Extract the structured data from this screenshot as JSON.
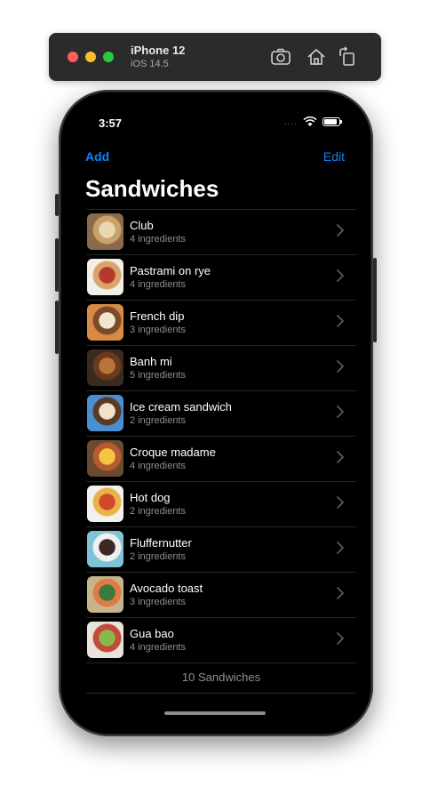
{
  "simulator": {
    "device_name": "iPhone 12",
    "os_version": "iOS 14.5",
    "buttons": [
      "screenshot-icon",
      "home-icon",
      "rotate-icon"
    ]
  },
  "status_bar": {
    "time": "3:57",
    "signal": "....",
    "battery_level": 0.85
  },
  "nav": {
    "add_label": "Add",
    "edit_label": "Edit",
    "title": "Sandwiches"
  },
  "sandwiches": [
    {
      "name": "Club",
      "detail": "4 ingredients"
    },
    {
      "name": "Pastrami on rye",
      "detail": "4 ingredients"
    },
    {
      "name": "French dip",
      "detail": "3 ingredients"
    },
    {
      "name": "Banh mi",
      "detail": "5 ingredients"
    },
    {
      "name": "Ice cream sandwich",
      "detail": "2 ingredients"
    },
    {
      "name": "Croque madame",
      "detail": "4 ingredients"
    },
    {
      "name": "Hot dog",
      "detail": "2 ingredients"
    },
    {
      "name": "Fluffernutter",
      "detail": "2 ingredients"
    },
    {
      "name": "Avocado toast",
      "detail": "3 ingredients"
    },
    {
      "name": "Gua bao",
      "detail": "4 ingredients"
    }
  ],
  "footer": {
    "count_label": "10 Sandwiches"
  },
  "colors": {
    "accent": "#0a84ff",
    "background": "#000000",
    "secondary_text": "#8e8e93"
  }
}
